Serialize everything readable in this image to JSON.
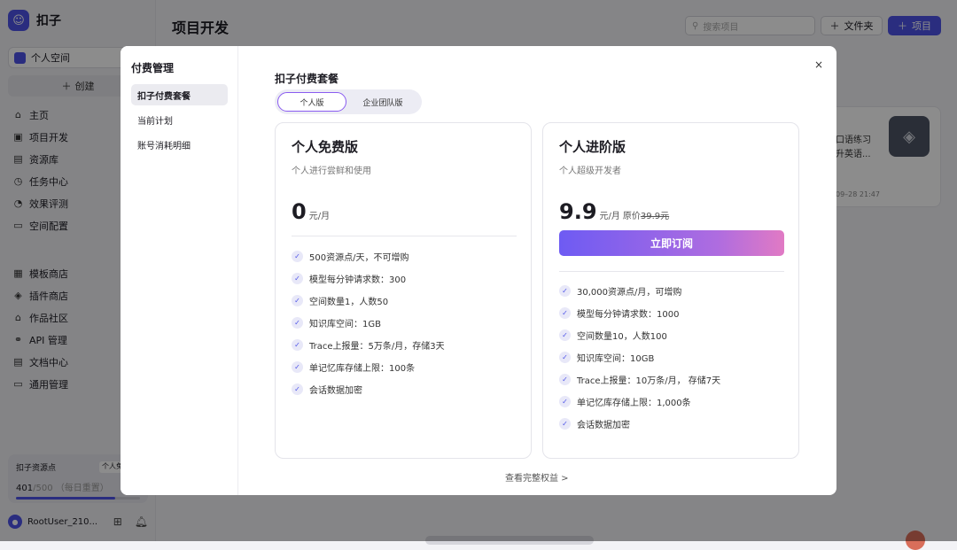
{
  "brand": {
    "name": "扣子"
  },
  "sidebar": {
    "space": "个人空间",
    "create": "创建",
    "nav": [
      {
        "label": "主页",
        "icon": "home-icon",
        "glyph": "⌂"
      },
      {
        "label": "项目开发",
        "icon": "project-dev-icon",
        "glyph": "▣"
      },
      {
        "label": "资源库",
        "icon": "library-icon",
        "glyph": "▤"
      },
      {
        "label": "任务中心",
        "icon": "task-icon",
        "glyph": "◷"
      },
      {
        "label": "效果评测",
        "icon": "evaluate-icon",
        "glyph": "◔"
      },
      {
        "label": "空间配置",
        "icon": "space-config-icon",
        "glyph": "▭"
      }
    ],
    "nav2": [
      {
        "label": "模板商店",
        "icon": "template-icon",
        "glyph": "▦"
      },
      {
        "label": "插件商店",
        "icon": "plugin-icon",
        "glyph": "◈"
      },
      {
        "label": "作品社区",
        "icon": "community-icon",
        "glyph": "⌂"
      },
      {
        "label": "API 管理",
        "icon": "api-icon",
        "glyph": "⚭"
      },
      {
        "label": "文档中心",
        "icon": "docs-icon",
        "glyph": "▤"
      },
      {
        "label": "通用管理",
        "icon": "general-icon",
        "glyph": "▭"
      }
    ],
    "resource": {
      "title": "扣子资源点",
      "tag": "个人免费版",
      "used": "401",
      "total": "/500",
      "note": "（每日重置）",
      "fraction": 0.802
    },
    "user": {
      "name": "RootUser_210..."
    }
  },
  "header": {
    "title": "项目开发",
    "search_placeholder": "搜索项目",
    "folder_label": "文件夹",
    "project_label": "项目"
  },
  "bg_card": {
    "title_line1": "口语练习",
    "title_line2": "升英语...",
    "time": "09–28 21:47"
  },
  "modal": {
    "title": "付费管理",
    "menu": [
      "扣子付费套餐",
      "当前计划",
      "账号消耗明细"
    ],
    "close": "×",
    "plans_title": "扣子付费套餐",
    "tabs": [
      "个人版",
      "企业团队版"
    ],
    "free": {
      "title": "个人免费版",
      "subtitle": "个人进行尝鲜和使用",
      "price": "0",
      "unit": "元/月",
      "features": [
        "500资源点/天，不可增购",
        "模型每分钟请求数：300",
        "空间数量1，人数50",
        "知识库空间：1GB",
        "Trace上报量：5万条/月，存储3天",
        "单记忆库存储上限：100条",
        "会话数据加密"
      ]
    },
    "pro": {
      "title": "个人进阶版",
      "subtitle": "个人超级开发者",
      "price": "9.9",
      "unit": "元/月",
      "orig_label": "原价",
      "orig_price": "39.9元",
      "button": "立即订阅",
      "features": [
        "30,000资源点/月，可增购",
        "模型每分钟请求数：1000",
        "空间数量10，人数100",
        "知识库空间：10GB",
        "Trace上报量：10万条/月， 存储7天",
        "单记忆库存储上限：1,000条",
        "会话数据加密"
      ]
    },
    "more": "查看完整权益 >"
  }
}
